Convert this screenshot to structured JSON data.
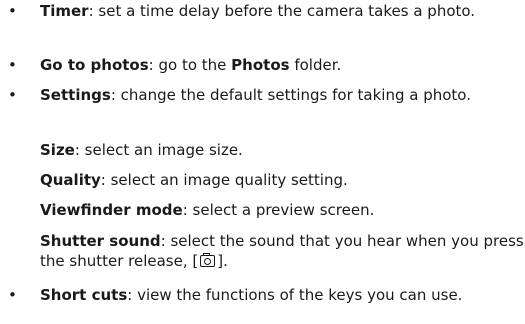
{
  "bullet_char": "•",
  "timer": {
    "term": "Timer",
    "desc": ": set a time delay before the camera takes a photo."
  },
  "go_to_photos": {
    "term": "Go to photos",
    "desc_before": ": go to the ",
    "folder": "Photos",
    "desc_after": " folder."
  },
  "settings": {
    "term": "Settings",
    "desc": ": change the default settings for taking a photo.",
    "sub_items": [
      {
        "term": "Size",
        "desc": ": select an image size."
      },
      {
        "term": "Quality",
        "desc": ": select an image quality setting."
      },
      {
        "term": "Viewfinder mode",
        "desc": ": select a preview screen."
      },
      {
        "term": "Shutter sound",
        "desc_before": ": select the sound that you hear when you press the shutter release, [",
        "desc_after": "]."
      }
    ]
  },
  "short_cuts": {
    "term": "Short cuts",
    "desc": ": view the functions of the keys you can use."
  },
  "icons": {
    "camera_key": "camera-key-icon"
  }
}
